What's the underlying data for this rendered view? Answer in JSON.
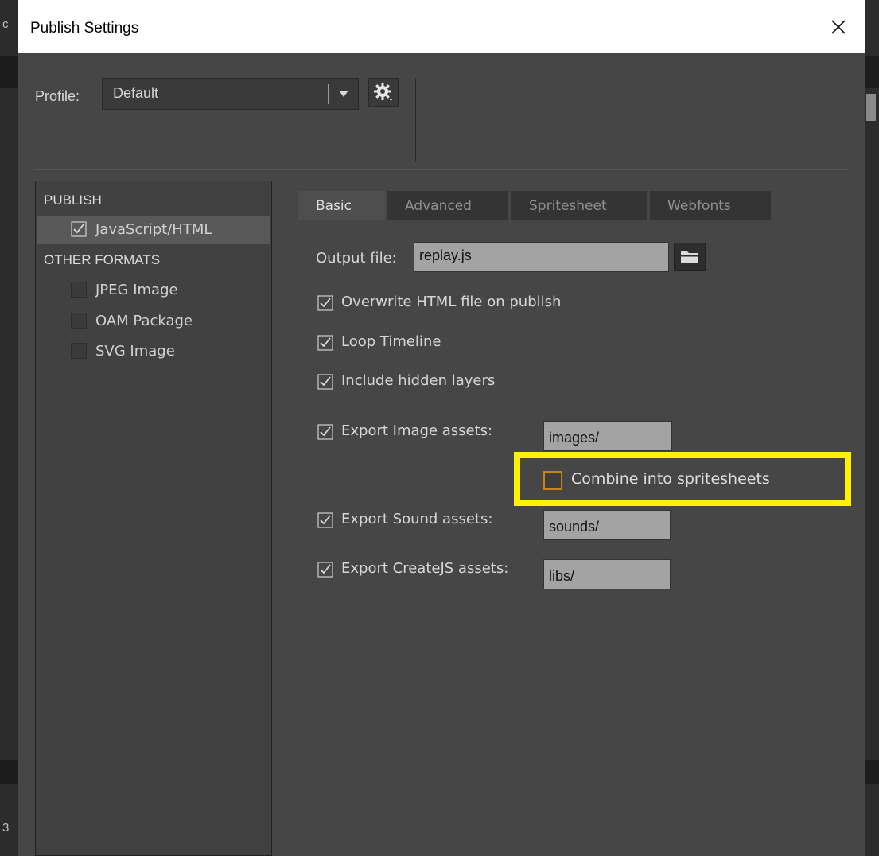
{
  "window": {
    "title": "Publish Settings"
  },
  "profile": {
    "label": "Profile:",
    "value": "Default"
  },
  "left_pane": {
    "publish_heading": "PUBLISH",
    "publish_items": [
      {
        "label": "JavaScript/HTML",
        "checked": true,
        "selected": true
      }
    ],
    "other_heading": "OTHER FORMATS",
    "other_items": [
      {
        "label": "JPEG Image",
        "checked": false
      },
      {
        "label": "OAM Package",
        "checked": false
      },
      {
        "label": "SVG Image",
        "checked": false
      }
    ]
  },
  "tabs": [
    {
      "label": "Basic",
      "active": true
    },
    {
      "label": "Advanced",
      "active": false
    },
    {
      "label": "Spritesheet",
      "active": false
    },
    {
      "label": "Webfonts",
      "active": false
    }
  ],
  "basic": {
    "output_file_label": "Output file:",
    "output_file_value": "replay.js",
    "overwrite_html": "Overwrite HTML file on publish",
    "loop_timeline": "Loop Timeline",
    "include_hidden": "Include hidden layers",
    "export_image": "Export Image assets:",
    "export_image_path": "images/",
    "combine_spritesheets": "Combine into spritesheets",
    "export_sound": "Export Sound assets:",
    "export_sound_path": "sounds/",
    "export_createjs": "Export CreateJS assets:",
    "export_createjs_path": "libs/"
  },
  "background": {
    "left_letter_top": "c",
    "left_letter_bottom": "3"
  },
  "colors": {
    "highlight": "#fff200",
    "dialog_bg": "#464646",
    "focus_border": "#c8850f"
  },
  "icons": {
    "close": "close-icon",
    "dropdown": "chevron-down-icon",
    "settings": "gear-icon",
    "folder": "folder-icon",
    "check": "checkmark-icon"
  }
}
